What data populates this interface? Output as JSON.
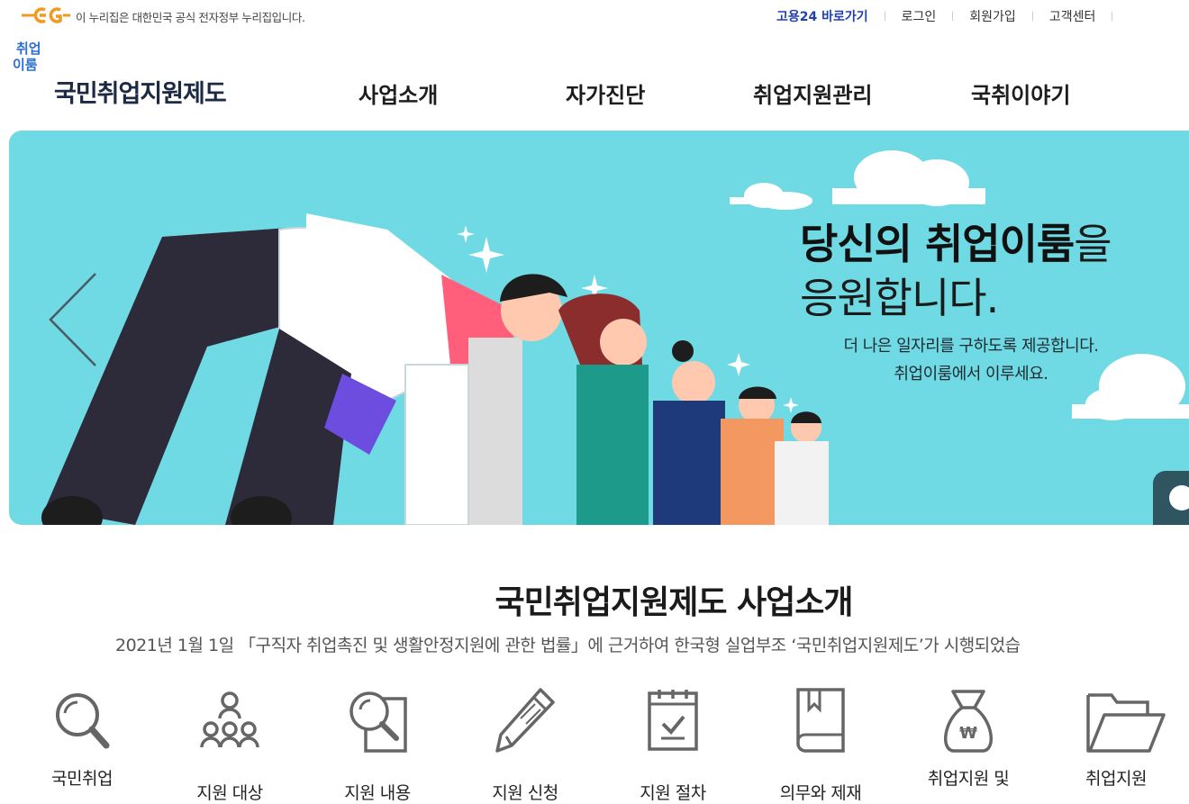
{
  "topbar": {
    "gov_notice": "이 누리집은 대한민국 공식 전자정부 누리집입니다.",
    "links": [
      {
        "label": "고용24 바로가기",
        "strong": true
      },
      {
        "label": "로그인"
      },
      {
        "label": "회원가입"
      },
      {
        "label": "고객센터"
      }
    ]
  },
  "brand": {
    "small_line1": "취업",
    "small_line2": "이룸",
    "name": "국민취업지원제도"
  },
  "gnb": [
    "사업소개",
    "자가진단",
    "취업지원관리",
    "국취이야기"
  ],
  "hero": {
    "title_bold": "당신의 취업이룸",
    "title_suffix": "을",
    "title_line2": "응원합니다.",
    "sub_line1": "더 나은 일자리를 구하도록 제공합니다.",
    "sub_line2": "취업이룸에서 이루세요.",
    "background_color": "#6fd9e4"
  },
  "intro": {
    "title": "국민취업지원제도 사업소개",
    "description": "2021년 1월 1일 「구직자 취업촉진 및 생활안정지원에 관한 법률」에 근거하여 한국형 실업부조 ‘국민취업지원제도’가 시행되었습"
  },
  "quick_menu": [
    {
      "icon": "magnifier-icon",
      "label": "국민취업"
    },
    {
      "icon": "people-group-icon",
      "label": "지원 대상"
    },
    {
      "icon": "search-document-icon",
      "label": "지원 내용"
    },
    {
      "icon": "pencil-icon",
      "label": "지원 신청"
    },
    {
      "icon": "calendar-check-icon",
      "label": "지원 절차"
    },
    {
      "icon": "book-icon",
      "label": "의무와 제재"
    },
    {
      "icon": "money-bag-icon",
      "label": "취업지원 및"
    },
    {
      "icon": "folder-icon",
      "label": "취업지원"
    }
  ],
  "money_symbol": "₩"
}
